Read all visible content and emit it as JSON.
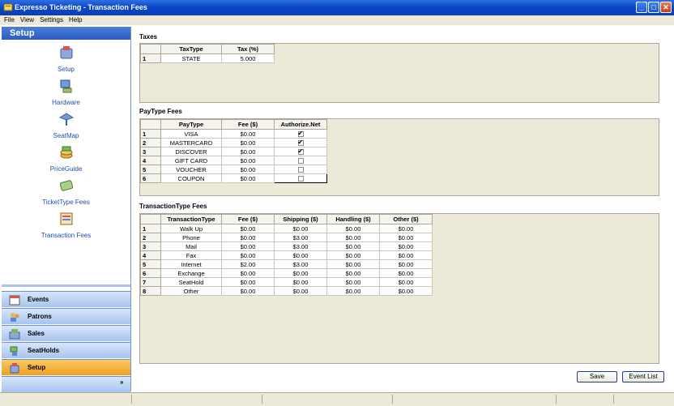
{
  "window": {
    "title": "Expresso Ticketing - Transaction Fees",
    "controls": [
      "_",
      "□",
      "✕"
    ]
  },
  "menu": [
    "File",
    "View",
    "Settings",
    "Help"
  ],
  "sidebar": {
    "header": "Setup",
    "items": [
      {
        "label": "Setup",
        "icon": "setup-icon"
      },
      {
        "label": "Hardware",
        "icon": "hardware-icon"
      },
      {
        "label": "SeatMap",
        "icon": "seatmap-icon"
      },
      {
        "label": "PriceGuide",
        "icon": "priceguide-icon"
      },
      {
        "label": "TicketType Fees",
        "icon": "ticket-icon"
      },
      {
        "label": "Transaction Fees",
        "icon": "transaction-icon"
      }
    ],
    "outlook": [
      {
        "label": "Events",
        "icon": "calendar-icon"
      },
      {
        "label": "Patrons",
        "icon": "patrons-icon"
      },
      {
        "label": "Sales",
        "icon": "sales-icon"
      },
      {
        "label": "SeatHolds",
        "icon": "seathold-icon"
      },
      {
        "label": "Setup",
        "icon": "setup-icon",
        "active": true
      }
    ],
    "more": "»"
  },
  "taxes": {
    "title": "Taxes",
    "headers": [
      "TaxType",
      "Tax (%)"
    ],
    "rows": [
      {
        "n": "1",
        "cells": [
          "STATE",
          "5.000"
        ]
      }
    ]
  },
  "paytype": {
    "title": "PayType Fees",
    "headers": [
      "PayType",
      "Fee ($)",
      "Authorize.Net"
    ],
    "rows": [
      {
        "n": "1",
        "cells": [
          "VISA",
          "$0.00"
        ],
        "auth": true
      },
      {
        "n": "2",
        "cells": [
          "MASTERCARD",
          "$0.00"
        ],
        "auth": true
      },
      {
        "n": "3",
        "cells": [
          "DISCOVER",
          "$0.00"
        ],
        "auth": true
      },
      {
        "n": "4",
        "cells": [
          "GIFT CARD",
          "$0.00"
        ],
        "auth": false
      },
      {
        "n": "5",
        "cells": [
          "VOUCHER",
          "$0.00"
        ],
        "auth": false
      },
      {
        "n": "6",
        "cells": [
          "COUPON",
          "$0.00"
        ],
        "auth": false
      }
    ]
  },
  "transtype": {
    "title": "TransactionType Fees",
    "headers": [
      "TransactionType",
      "Fee ($)",
      "Shipping ($)",
      "Handling ($)",
      "Other ($)"
    ],
    "rows": [
      {
        "n": "1",
        "cells": [
          "Walk Up",
          "$0.00",
          "$0.00",
          "$0.00",
          "$0.00"
        ]
      },
      {
        "n": "2",
        "cells": [
          "Phone",
          "$0.00",
          "$3.00",
          "$0.00",
          "$0.00"
        ]
      },
      {
        "n": "3",
        "cells": [
          "Mail",
          "$0.00",
          "$3.00",
          "$0.00",
          "$0.00"
        ]
      },
      {
        "n": "4",
        "cells": [
          "Fax",
          "$0.00",
          "$0.00",
          "$0.00",
          "$0.00"
        ]
      },
      {
        "n": "5",
        "cells": [
          "Internet",
          "$2.00",
          "$3.00",
          "$0.00",
          "$0.00"
        ]
      },
      {
        "n": "6",
        "cells": [
          "Exchange",
          "$0.00",
          "$0.00",
          "$0.00",
          "$0.00"
        ]
      },
      {
        "n": "7",
        "cells": [
          "SeatHold",
          "$0.00",
          "$0.00",
          "$0.00",
          "$0.00"
        ]
      },
      {
        "n": "8",
        "cells": [
          "Other",
          "$0.00",
          "$0.00",
          "$0.00",
          "$0.00"
        ]
      }
    ]
  },
  "buttons": {
    "save": "Save",
    "event_list": "Event List"
  }
}
